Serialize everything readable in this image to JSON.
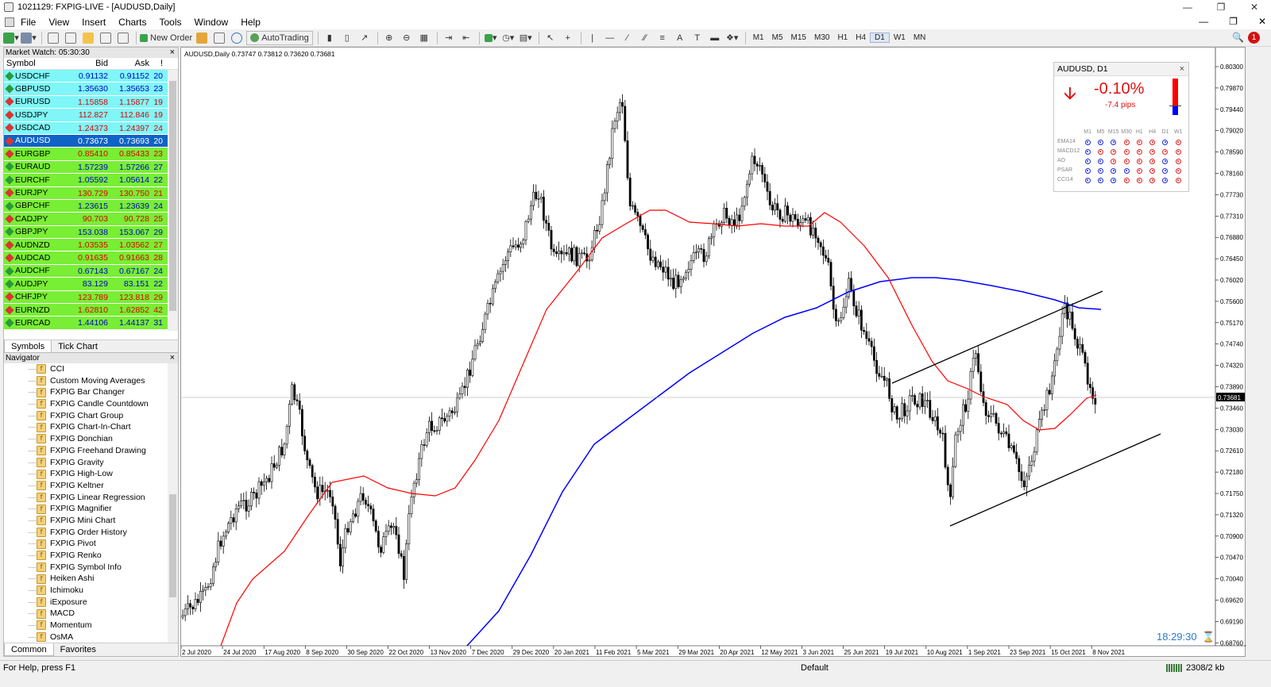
{
  "window": {
    "title": "1021129: FXPIG-LIVE - [AUDUSD,Daily]"
  },
  "menu": [
    "File",
    "View",
    "Insert",
    "Charts",
    "Tools",
    "Window",
    "Help"
  ],
  "toolbar": {
    "new_order": "New Order",
    "autotrading": "AutoTrading",
    "timeframes": [
      "M1",
      "M5",
      "M15",
      "M30",
      "H1",
      "H4",
      "D1",
      "W1",
      "MN"
    ],
    "active_timeframe": "D1",
    "alerts_badge": "1"
  },
  "market_watch": {
    "title": "Market Watch: 05:30:30",
    "columns": [
      "Symbol",
      "Bid",
      "Ask",
      "!"
    ],
    "rows": [
      {
        "symbol": "USDCHF",
        "bid": "0.91132",
        "ask": "0.91152",
        "spread": "20",
        "dir": "up",
        "bg": "cyan",
        "color": "blue"
      },
      {
        "symbol": "GBPUSD",
        "bid": "1.35630",
        "ask": "1.35653",
        "spread": "23",
        "dir": "up",
        "bg": "cyan",
        "color": "blue"
      },
      {
        "symbol": "EURUSD",
        "bid": "1.15858",
        "ask": "1.15877",
        "spread": "19",
        "dir": "down",
        "bg": "cyan",
        "color": "red"
      },
      {
        "symbol": "USDJPY",
        "bid": "112.827",
        "ask": "112.846",
        "spread": "19",
        "dir": "down",
        "bg": "cyan",
        "color": "red"
      },
      {
        "symbol": "USDCAD",
        "bid": "1.24373",
        "ask": "1.24397",
        "spread": "24",
        "dir": "down",
        "bg": "cyan",
        "color": "red"
      },
      {
        "symbol": "AUDUSD",
        "bid": "0.73673",
        "ask": "0.73693",
        "spread": "20",
        "dir": "down",
        "bg": "sel",
        "color": "white"
      },
      {
        "symbol": "EURGBP",
        "bid": "0.85410",
        "ask": "0.85433",
        "spread": "23",
        "dir": "down",
        "bg": "green",
        "color": "red"
      },
      {
        "symbol": "EURAUD",
        "bid": "1.57239",
        "ask": "1.57266",
        "spread": "27",
        "dir": "up",
        "bg": "green",
        "color": "blue"
      },
      {
        "symbol": "EURCHF",
        "bid": "1.05592",
        "ask": "1.05614",
        "spread": "22",
        "dir": "up",
        "bg": "green",
        "color": "blue"
      },
      {
        "symbol": "EURJPY",
        "bid": "130.729",
        "ask": "130.750",
        "spread": "21",
        "dir": "down",
        "bg": "green",
        "color": "red"
      },
      {
        "symbol": "GBPCHF",
        "bid": "1.23615",
        "ask": "1.23639",
        "spread": "24",
        "dir": "up",
        "bg": "green",
        "color": "blue"
      },
      {
        "symbol": "CADJPY",
        "bid": "90.703",
        "ask": "90.728",
        "spread": "25",
        "dir": "down",
        "bg": "green",
        "color": "red"
      },
      {
        "symbol": "GBPJPY",
        "bid": "153.038",
        "ask": "153.067",
        "spread": "29",
        "dir": "up",
        "bg": "green",
        "color": "blue"
      },
      {
        "symbol": "AUDNZD",
        "bid": "1.03535",
        "ask": "1.03562",
        "spread": "27",
        "dir": "down",
        "bg": "green",
        "color": "red"
      },
      {
        "symbol": "AUDCAD",
        "bid": "0.91635",
        "ask": "0.91663",
        "spread": "28",
        "dir": "down",
        "bg": "green",
        "color": "red"
      },
      {
        "symbol": "AUDCHF",
        "bid": "0.67143",
        "ask": "0.67167",
        "spread": "24",
        "dir": "up",
        "bg": "green",
        "color": "blue"
      },
      {
        "symbol": "AUDJPY",
        "bid": "83.129",
        "ask": "83.151",
        "spread": "22",
        "dir": "up",
        "bg": "green",
        "color": "blue"
      },
      {
        "symbol": "CHFJPY",
        "bid": "123.789",
        "ask": "123.818",
        "spread": "29",
        "dir": "down",
        "bg": "green",
        "color": "red"
      },
      {
        "symbol": "EURNZD",
        "bid": "1.62810",
        "ask": "1.62852",
        "spread": "42",
        "dir": "down",
        "bg": "green",
        "color": "red"
      },
      {
        "symbol": "EURCAD",
        "bid": "1.44106",
        "ask": "1.44137",
        "spread": "31",
        "dir": "up",
        "bg": "green",
        "color": "blue"
      }
    ],
    "tabs": [
      "Symbols",
      "Tick Chart"
    ]
  },
  "navigator": {
    "title": "Navigator",
    "items": [
      "CCI",
      "Custom Moving Averages",
      "FXPIG Bar Changer",
      "FXPIG Candle Countdown",
      "FXPIG Chart Group",
      "FXPIG Chart-In-Chart",
      "FXPIG Donchian",
      "FXPIG Freehand Drawing",
      "FXPIG Gravity",
      "FXPIG High-Low",
      "FXPIG Keltner",
      "FXPIG Linear Regression",
      "FXPIG Magnifier",
      "FXPIG Mini Chart",
      "FXPIG Order History",
      "FXPIG Pivot",
      "FXPIG Renko",
      "FXPIG Symbol Info",
      "Heiken Ashi",
      "Ichimoku",
      "iExposure",
      "MACD",
      "Momentum",
      "OsMA"
    ],
    "tabs": [
      "Common",
      "Favorites"
    ]
  },
  "chart": {
    "header": "AUDUSD,Daily  0.73747 0.73812 0.73620 0.73681",
    "price_labels": [
      "0.80300",
      "0.79870",
      "0.79440",
      "0.79020",
      "0.78590",
      "0.78160",
      "0.77730",
      "0.77310",
      "0.76880",
      "0.76450",
      "0.76020",
      "0.75600",
      "0.75170",
      "0.74740",
      "0.74320",
      "0.73890",
      "0.73460",
      "0.73030",
      "0.72610",
      "0.72180",
      "0.71750",
      "0.71320",
      "0.70900",
      "0.70470",
      "0.70040",
      "0.69620",
      "0.69190",
      "0.68760"
    ],
    "current_price": "0.73681",
    "date_labels": [
      "2 Jul 2020",
      "24 Jul 2020",
      "17 Aug 2020",
      "8 Sep 2020",
      "30 Sep 2020",
      "22 Oct 2020",
      "13 Nov 2020",
      "7 Dec 2020",
      "29 Dec 2020",
      "20 Jan 2021",
      "11 Feb 2021",
      "5 Mar 2021",
      "29 Mar 2021",
      "20 Apr 2021",
      "12 May 2021",
      "3 Jun 2021",
      "25 Jun 2021",
      "19 Jul 2021",
      "10 Aug 2021",
      "1 Sep 2021",
      "23 Sep 2021",
      "15 Oct 2021",
      "8 Nov 2021"
    ],
    "clock": "18:29:30",
    "colors": {
      "ma_fast": "#ff0000",
      "ma_slow": "#0000ff",
      "candle": "#000000",
      "channel": "#000000"
    }
  },
  "info_panel": {
    "title": "AUDUSD, D1",
    "change": "-0.10%",
    "pips": "-7.4 pips",
    "timeframes": [
      "M1",
      "M5",
      "M15",
      "M30",
      "H1",
      "H4",
      "D1",
      "W1"
    ],
    "indicators": [
      {
        "name": "EMA14",
        "states": [
          "b",
          "b",
          "b",
          "r",
          "r",
          "r",
          "b",
          "r"
        ]
      },
      {
        "name": "MACD12",
        "states": [
          "b",
          "r",
          "r",
          "r",
          "r",
          "r",
          "r",
          "r"
        ]
      },
      {
        "name": "AO",
        "states": [
          "b",
          "b",
          "r",
          "r",
          "r",
          "r",
          "b",
          "r"
        ]
      },
      {
        "name": "PSAR",
        "states": [
          "b",
          "b",
          "b",
          "b",
          "r",
          "r",
          "b",
          "r"
        ]
      },
      {
        "name": "CCI14",
        "states": [
          "b",
          "b",
          "b",
          "r",
          "r",
          "r",
          "b",
          "r"
        ]
      }
    ]
  },
  "status": {
    "help": "For Help, press F1",
    "profile": "Default",
    "traffic": "2308/2 kb"
  }
}
